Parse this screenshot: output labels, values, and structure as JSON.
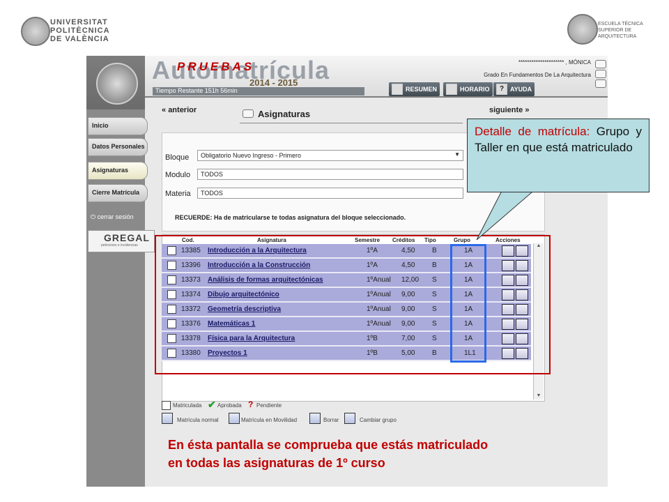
{
  "header": {
    "upv_line1": "UNIVERSITAT",
    "upv_line2": "POLITÈCNICA",
    "upv_line3": "DE VALÈNCIA",
    "etsa_line1": "ESCUELA TÉCNICA",
    "etsa_line2": "SUPERIOR DE",
    "etsa_line3": "ARQUITECTURA"
  },
  "app": {
    "name": "Automatrícula",
    "watermark": "PRUEBAS",
    "year": "2014 - 2015",
    "time_remaining": "Tiempo Restante 151h 56min",
    "user": "********************* , MÓNICA",
    "degree": "Grado En Fundamentos De La Arquitectura",
    "buttons": {
      "resumen": "RESUMEN",
      "horario": "HORARIO",
      "ayuda": "AYUDA"
    }
  },
  "sidebar": {
    "items": [
      "Inicio",
      "Datos Personales",
      "Asignaturas",
      "Cierre Matrícula"
    ],
    "logout": "cerrar sesión",
    "gregal": "GREGAL",
    "gregal_sub": "peticiones e incidencias"
  },
  "nav": {
    "prev": "anterior",
    "next": "siguiente",
    "section_title": "Asignaturas"
  },
  "form": {
    "bloque_label": "Bloque",
    "bloque_value": "Obligatorio Nuevo Ingreso  -  Primero",
    "modulo_label": "Modulo",
    "modulo_value": "TODOS",
    "materia_label": "Materia",
    "materia_value": "TODOS",
    "reminder": "RECUERDE: Ha de matricularse te todas asignatura del bloque seleccionado."
  },
  "table": {
    "headers": [
      "Cod.",
      "Asignatura",
      "Semestre",
      "Créditos",
      "Tipo",
      "Grupo",
      "Acciones"
    ],
    "rows": [
      {
        "cod": "13385",
        "asignatura": "Introducción a la Arquitectura",
        "semestre": "1ºA",
        "creditos": "4,50",
        "tipo": "B",
        "grupo": "1A"
      },
      {
        "cod": "13396",
        "asignatura": "Introducción a la Construcción",
        "semestre": "1ºA",
        "creditos": "4,50",
        "tipo": "B",
        "grupo": "1A"
      },
      {
        "cod": "13373",
        "asignatura": "Análisis de formas arquitectónicas",
        "semestre": "1ºAnual",
        "creditos": "12,00",
        "tipo": "S",
        "grupo": "1A"
      },
      {
        "cod": "13374",
        "asignatura": "Dibujo arquitectónico",
        "semestre": "1ºAnual",
        "creditos": "9,00",
        "tipo": "S",
        "grupo": "1A"
      },
      {
        "cod": "13372",
        "asignatura": "Geometría descriptiva",
        "semestre": "1ºAnual",
        "creditos": "9,00",
        "tipo": "S",
        "grupo": "1A"
      },
      {
        "cod": "13376",
        "asignatura": "Matemáticas 1",
        "semestre": "1ºAnual",
        "creditos": "9,00",
        "tipo": "S",
        "grupo": "1A"
      },
      {
        "cod": "13378",
        "asignatura": "Física para la Arquitectura",
        "semestre": "1ºB",
        "creditos": "7,00",
        "tipo": "S",
        "grupo": "1A"
      },
      {
        "cod": "13380",
        "asignatura": "Proyectos 1",
        "semestre": "1ºB",
        "creditos": "5,00",
        "tipo": "B",
        "grupo": "1L1"
      }
    ]
  },
  "legend": {
    "matriculada": "Matriculada",
    "aprobada": "Aprobada",
    "pendiente": "Pendiente",
    "matricula_normal": "Matrícula normal",
    "matricula_movilidad": "Matrícula en Movilidad",
    "borrar": "Borrar",
    "cambiar_grupo": "Cambiar grupo"
  },
  "annotations": {
    "callout_title": "Detalle de matrícula:",
    "callout_body": "Grupo y Taller en que está matriculado",
    "note_line1": "En ésta pantalla se comprueba que estás matriculado",
    "note_line2": "en todas las asignaturas de 1º curso",
    "colors": {
      "red": "#c00000",
      "blue": "#2a6ae8",
      "callout_bg": "#b5dde2"
    }
  }
}
